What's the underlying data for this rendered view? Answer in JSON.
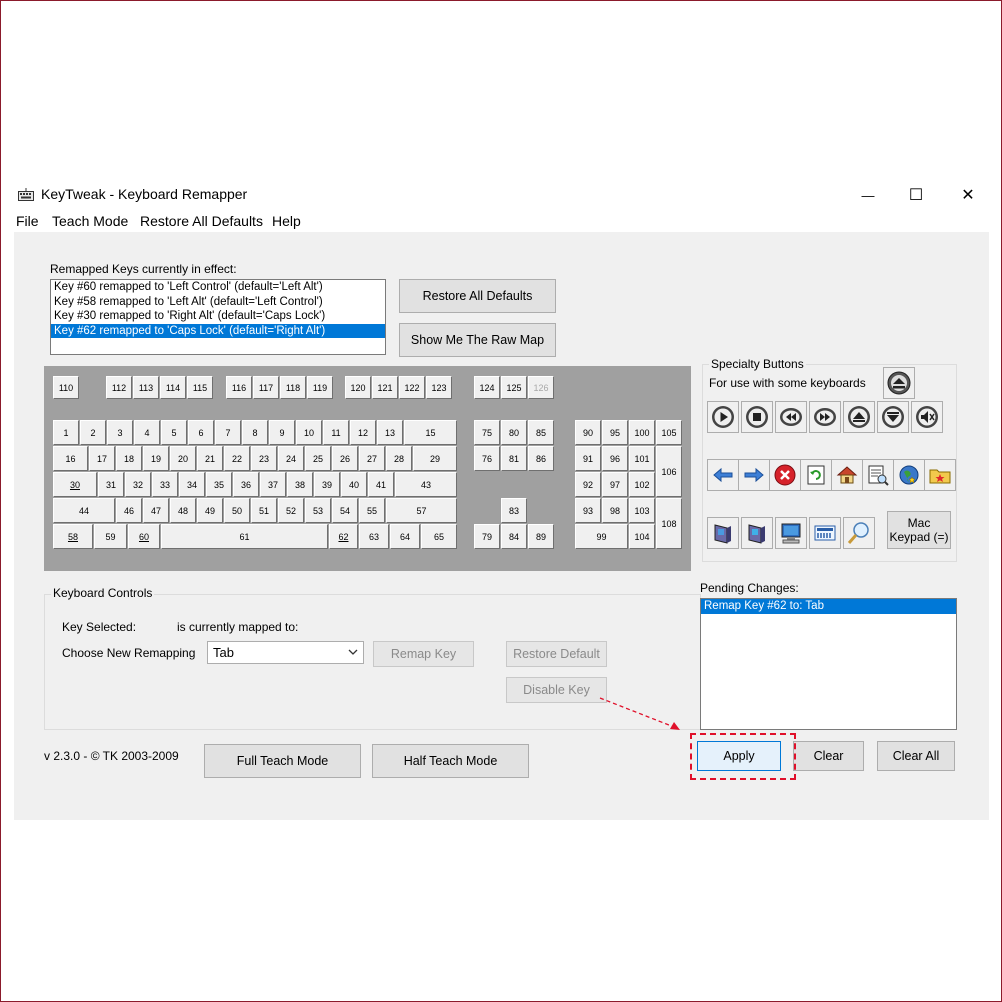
{
  "window": {
    "title": "KeyTweak -  Keyboard Remapper",
    "minimize_glyph": "—",
    "maximize_glyph": "☐",
    "close_glyph": "✕"
  },
  "menu": [
    "File",
    "Teach Mode",
    "Restore All Defaults",
    "Help"
  ],
  "remapped": {
    "label": "Remapped Keys currently in effect:",
    "items": [
      "Key #60 remapped to 'Left Control' (default='Left Alt')",
      "Key #58 remapped to 'Left Alt' (default='Left Control')",
      "Key #30 remapped to 'Right Alt' (default='Caps Lock')",
      "Key #62 remapped to 'Caps Lock' (default='Right Alt')"
    ],
    "selected_index": 3
  },
  "buttons": {
    "restore_all_defaults": "Restore All Defaults",
    "show_raw_map": "Show Me The Raw Map",
    "remap_key": "Remap Key",
    "restore_default": "Restore Default",
    "disable_key": "Disable Key",
    "full_teach": "Full Teach Mode",
    "half_teach": "Half Teach Mode",
    "apply": "Apply",
    "clear": "Clear",
    "clear_all": "Clear All"
  },
  "keyboard": {
    "fn_row": [
      "110",
      "112",
      "113",
      "114",
      "115",
      "116",
      "117",
      "118",
      "119",
      "120",
      "121",
      "122",
      "123",
      "124",
      "125",
      "126"
    ],
    "row1": [
      "1",
      "2",
      "3",
      "4",
      "5",
      "6",
      "7",
      "8",
      "9",
      "10",
      "11",
      "12",
      "13",
      "15"
    ],
    "row2": [
      "16",
      "17",
      "18",
      "19",
      "20",
      "21",
      "22",
      "23",
      "24",
      "25",
      "26",
      "27",
      "28",
      "29"
    ],
    "row3": [
      "30",
      "31",
      "32",
      "33",
      "34",
      "35",
      "36",
      "37",
      "38",
      "39",
      "40",
      "41",
      "43"
    ],
    "row4": [
      "44",
      "46",
      "47",
      "48",
      "49",
      "50",
      "51",
      "52",
      "53",
      "54",
      "55",
      "57"
    ],
    "row5": [
      "58",
      "59",
      "60",
      "61",
      "62",
      "63",
      "64",
      "65"
    ],
    "nav": [
      "75",
      "80",
      "85",
      "76",
      "81",
      "86",
      "83",
      "79",
      "84",
      "89"
    ],
    "numpad": [
      "90",
      "95",
      "100",
      "105",
      "91",
      "96",
      "101",
      "106",
      "92",
      "97",
      "102",
      "93",
      "98",
      "103",
      "108",
      "99",
      "104"
    ],
    "remapped_keys": [
      "30",
      "58",
      "60",
      "62"
    ],
    "disabled_keys": [
      "126"
    ]
  },
  "specialty": {
    "title": "Specialty Buttons",
    "subtitle": "For use with some keyboards",
    "mac_keypad_line1": "Mac",
    "mac_keypad_line2": "Keypad (=)",
    "icons_row1": [
      "play-icon",
      "stop-icon",
      "rewind-icon",
      "fast-forward-icon",
      "volume-up-icon",
      "volume-down-icon",
      "mute-icon"
    ],
    "icons_row2": [
      "back-arrow-icon",
      "forward-arrow-icon",
      "stop-red-icon",
      "refresh-icon",
      "home-icon",
      "search-page-icon",
      "favorites-globe-icon",
      "folder-star-icon"
    ],
    "icons_row3": [
      "my-computer-icon",
      "my-computer-2-icon",
      "monitor-icon",
      "calculator-icon",
      "magnifier-icon"
    ]
  },
  "controls": {
    "group_title": "Keyboard Controls",
    "key_selected_label": "Key Selected:",
    "mapped_to_label": "is currently mapped to:",
    "choose_label": "Choose New Remapping",
    "choose_value": "Tab"
  },
  "pending": {
    "label": "Pending Changes:",
    "items": [
      "Remap Key #62 to: Tab"
    ]
  },
  "version": "v 2.3.0 - © TK 2003-2009",
  "colors": {
    "selection": "#0078d7",
    "keyboard_bg": "#a0a0a0",
    "annotation": "#e0102a"
  }
}
